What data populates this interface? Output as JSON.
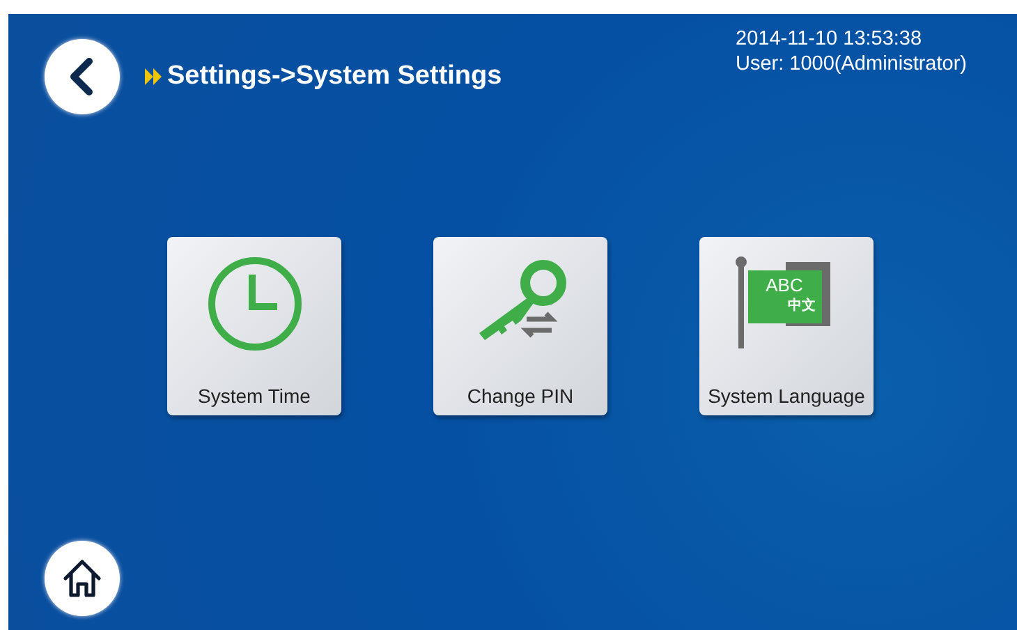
{
  "header": {
    "breadcrumb": "Settings->System Settings",
    "datetime": "2014-11-10  13:53:38",
    "user": "User: 1000(Administrator)"
  },
  "tiles": [
    {
      "kind": "clock",
      "label": "System Time"
    },
    {
      "kind": "key",
      "label": "Change PIN"
    },
    {
      "kind": "language",
      "label": "System Language",
      "icon_text": "ABC",
      "icon_subtext": "中文"
    }
  ]
}
